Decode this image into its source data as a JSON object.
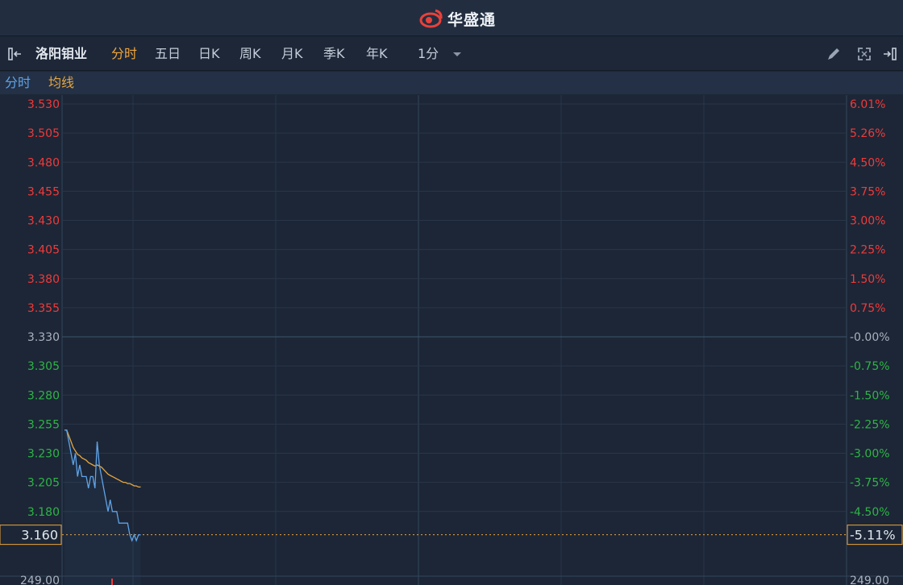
{
  "header": {
    "brand": "华盛通"
  },
  "toolbar": {
    "stock_name": "洛阳钼业",
    "tabs": [
      "分时",
      "五日",
      "日K",
      "周K",
      "月K",
      "季K",
      "年K"
    ],
    "active_tab": "分时",
    "interval": "1分"
  },
  "legend": {
    "line1": "分时",
    "line2": "均线"
  },
  "colors": {
    "price_line": "#5fa3e8",
    "avg_line": "#e6a640",
    "up": "#f03a3a",
    "down": "#2fb447",
    "base": "#a9b3bf",
    "current": "#f0a63c"
  },
  "chart_data": {
    "type": "line",
    "prev_close": 3.33,
    "ylim": [
      3.155,
      3.53
    ],
    "price_ticks": [
      "3.530",
      "3.505",
      "3.480",
      "3.455",
      "3.430",
      "3.405",
      "3.380",
      "3.355",
      "3.330",
      "3.305",
      "3.280",
      "3.255",
      "3.230",
      "3.205",
      "3.180"
    ],
    "pct_ticks": [
      "6.01%",
      "5.26%",
      "4.50%",
      "3.75%",
      "3.00%",
      "2.25%",
      "1.50%",
      "0.75%",
      "-0.00%",
      "-0.75%",
      "-1.50%",
      "-2.25%",
      "-3.00%",
      "-3.75%",
      "-4.50%"
    ],
    "current_price": "3.160",
    "current_pct": "-5.11%",
    "volume_left": "249.00",
    "volume_right": "249.00",
    "x_minutes_total": 330,
    "series": [
      {
        "name": "分时",
        "values": [
          3.25,
          3.25,
          3.24,
          3.23,
          3.22,
          3.23,
          3.21,
          3.22,
          3.21,
          3.21,
          3.21,
          3.2,
          3.21,
          3.21,
          3.2,
          3.24,
          3.22,
          3.21,
          3.2,
          3.19,
          3.18,
          3.19,
          3.18,
          3.18,
          3.18,
          3.17,
          3.17,
          3.17,
          3.17,
          3.17,
          3.16,
          3.155,
          3.16,
          3.155,
          3.16,
          3.16
        ]
      },
      {
        "name": "均线",
        "values": [
          3.25,
          3.25,
          3.245,
          3.24,
          3.235,
          3.232,
          3.229,
          3.228,
          3.226,
          3.225,
          3.224,
          3.222,
          3.221,
          3.22,
          3.219,
          3.22,
          3.219,
          3.218,
          3.216,
          3.214,
          3.212,
          3.211,
          3.21,
          3.209,
          3.208,
          3.207,
          3.206,
          3.205,
          3.205,
          3.204,
          3.204,
          3.203,
          3.202,
          3.202,
          3.201,
          3.201
        ]
      }
    ]
  }
}
